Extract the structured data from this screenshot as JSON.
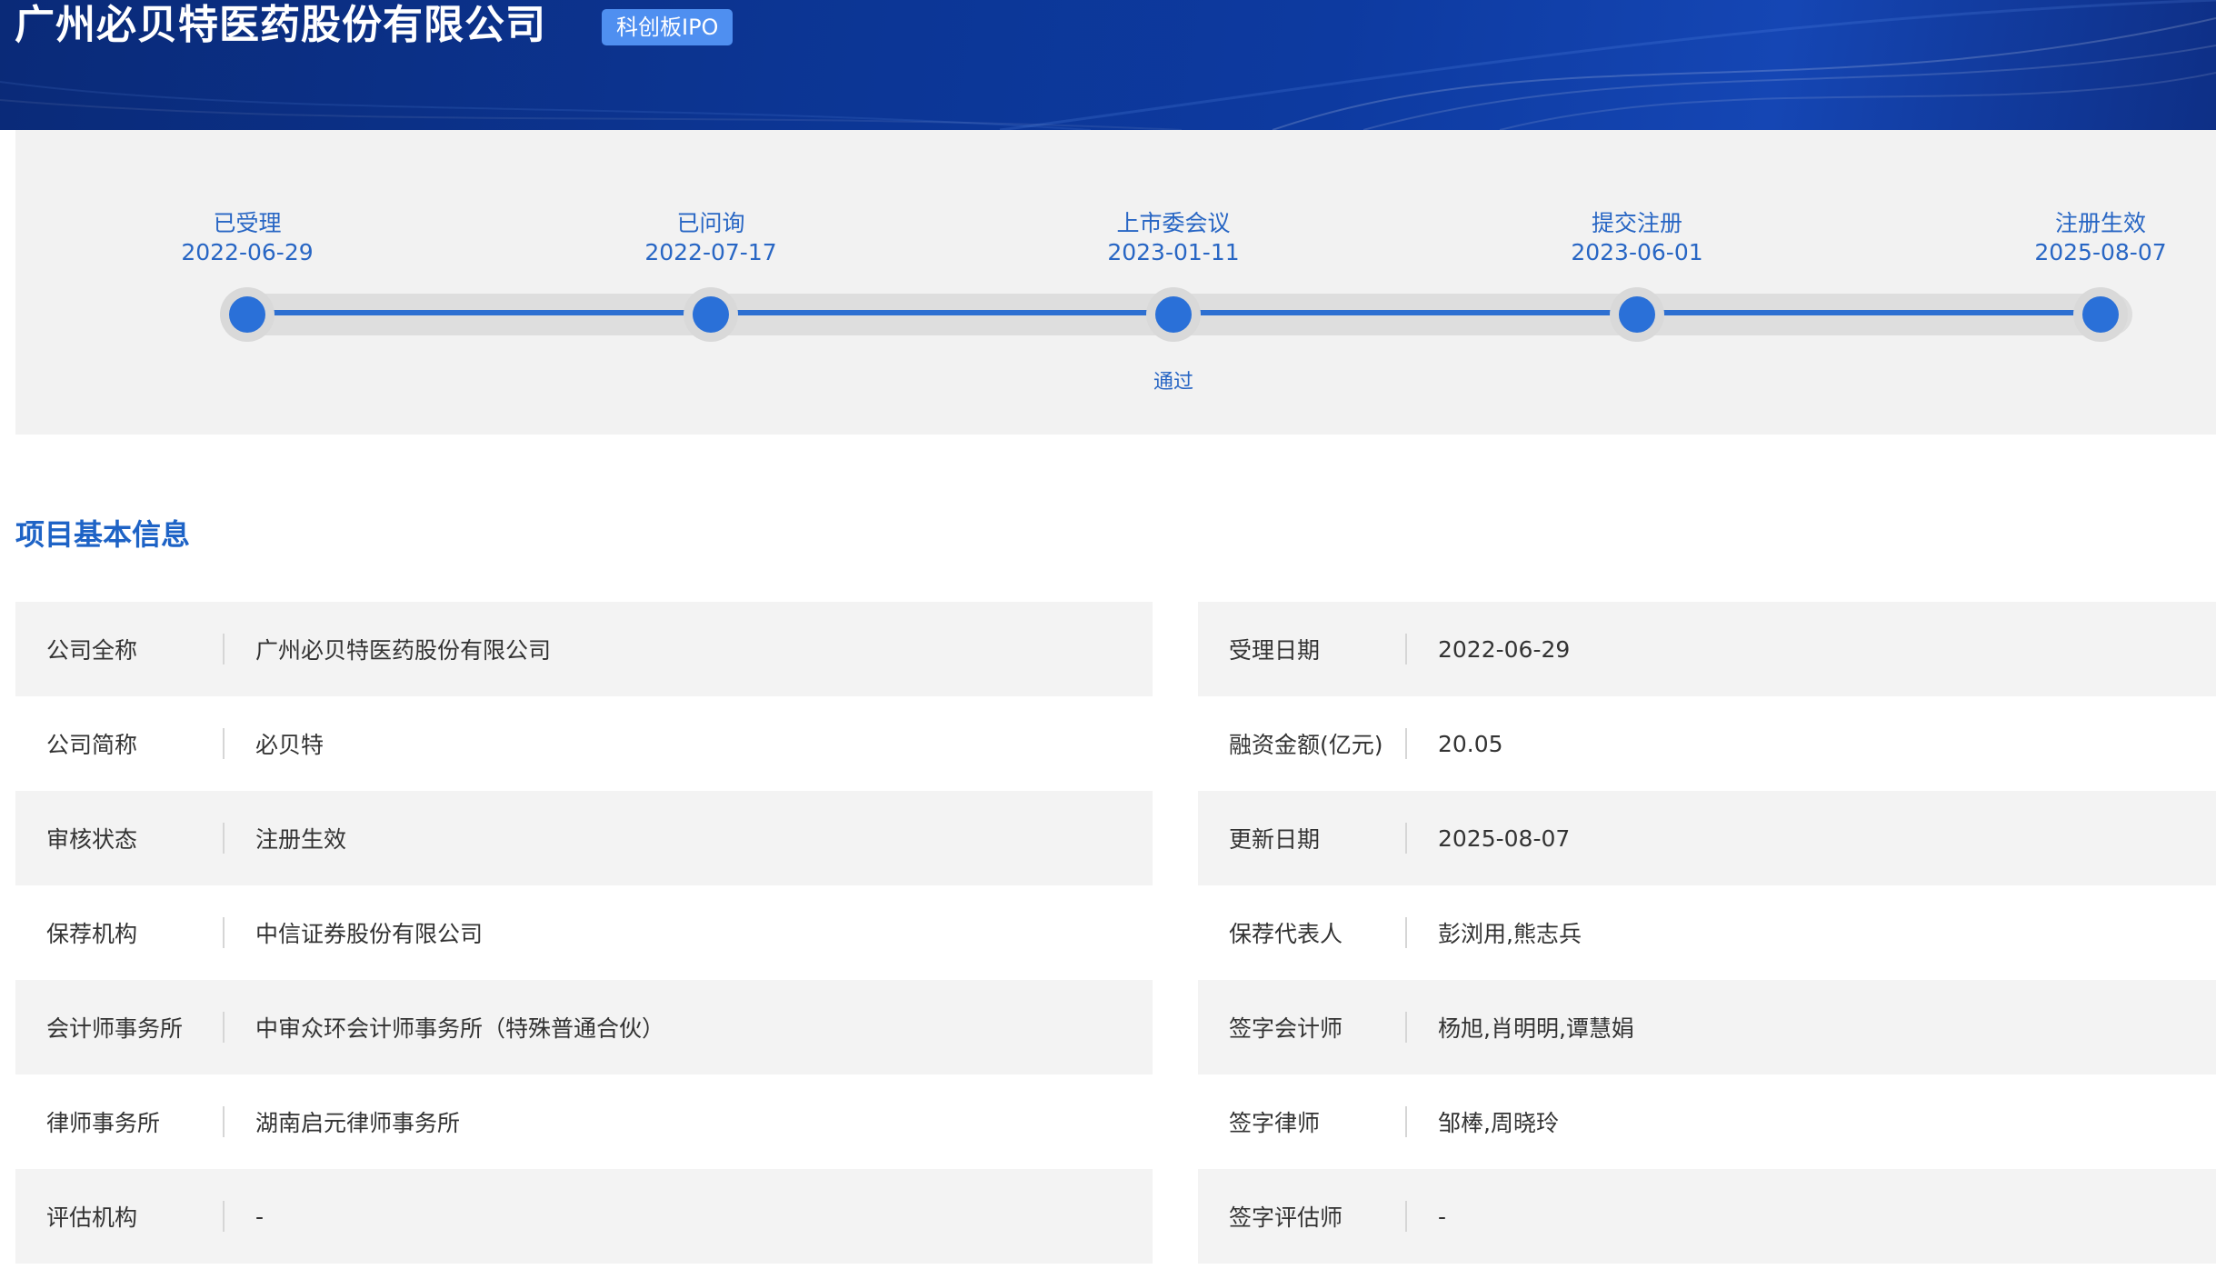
{
  "header": {
    "company_name": "广州必贝特医药股份有限公司",
    "badge": "科创板IPO"
  },
  "timeline": {
    "steps": [
      {
        "label": "已受理",
        "date": "2022-06-29",
        "note": ""
      },
      {
        "label": "已问询",
        "date": "2022-07-17",
        "note": ""
      },
      {
        "label": "上市委会议",
        "date": "2023-01-11",
        "note": "通过"
      },
      {
        "label": "提交注册",
        "date": "2023-06-01",
        "note": ""
      },
      {
        "label": "注册生效",
        "date": "2025-08-07",
        "note": ""
      }
    ],
    "current_step": 5
  },
  "section": {
    "title": "项目基本信息"
  },
  "info": {
    "left": [
      {
        "label": "公司全称",
        "value": "广州必贝特医药股份有限公司"
      },
      {
        "label": "公司简称",
        "value": "必贝特"
      },
      {
        "label": "审核状态",
        "value": "注册生效"
      },
      {
        "label": "保荐机构",
        "value": "中信证券股份有限公司"
      },
      {
        "label": "会计师事务所",
        "value": "中审众环会计师事务所（特殊普通合伙）"
      },
      {
        "label": "律师事务所",
        "value": "湖南启元律师事务所"
      },
      {
        "label": "评估机构",
        "value": "-"
      }
    ],
    "right": [
      {
        "label": "受理日期",
        "value": "2022-06-29"
      },
      {
        "label": "融资金额(亿元)",
        "value": "20.05"
      },
      {
        "label": "更新日期",
        "value": "2025-08-07"
      },
      {
        "label": "保荐代表人",
        "value": "彭浏用,熊志兵"
      },
      {
        "label": "签字会计师",
        "value": "杨旭,肖明明,谭慧娟"
      },
      {
        "label": "签字律师",
        "value": "邹棒,周晓玲"
      },
      {
        "label": "签字评估师",
        "value": "-"
      }
    ]
  },
  "colors": {
    "banner": "#0c3593",
    "badge": "#4f8ff0",
    "accent": "#2a70d8",
    "section_title": "#1e63c6",
    "row_shade": "#f3f3f3"
  }
}
